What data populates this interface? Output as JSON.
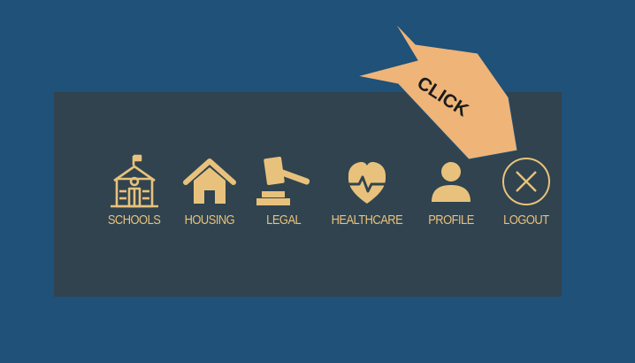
{
  "colors": {
    "background": "#1f5179",
    "panel": "#30434f",
    "accent": "#e8c27c",
    "callout": "#efb478"
  },
  "nav": {
    "items": [
      {
        "label": "SCHOOLS",
        "icon": "school-icon"
      },
      {
        "label": "HOUSING",
        "icon": "house-icon"
      },
      {
        "label": "LEGAL",
        "icon": "gavel-icon"
      },
      {
        "label": "HEALTHCARE",
        "icon": "heart-pulse-icon"
      },
      {
        "label": "PROFILE",
        "icon": "user-icon"
      },
      {
        "label": "LOGOUT",
        "icon": "close-circle-icon"
      }
    ]
  },
  "callout": {
    "text": "CLICK",
    "points_to": "LOGOUT"
  }
}
